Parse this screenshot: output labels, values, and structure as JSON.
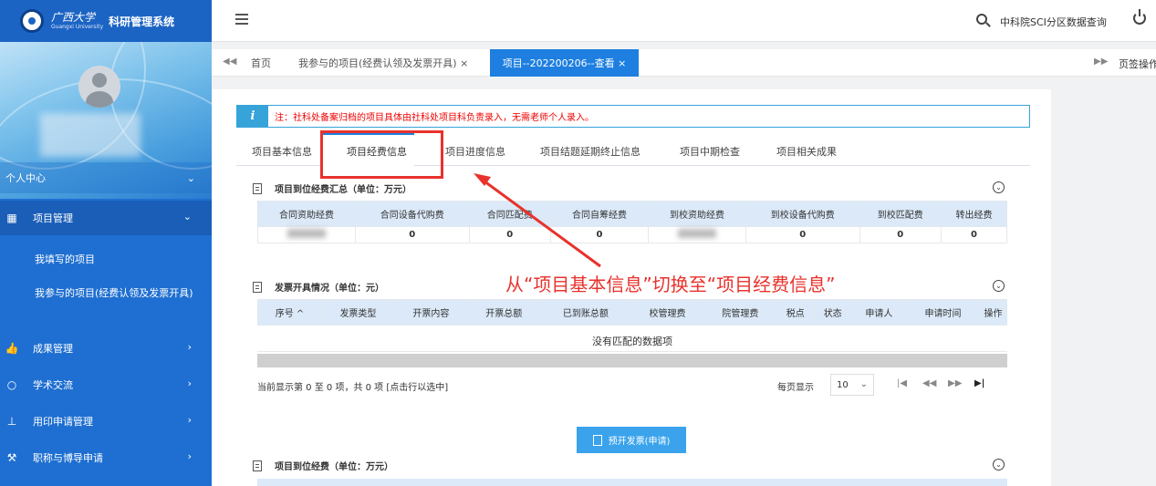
{
  "app": {
    "logo_cn": "广西大学",
    "logo_en": "Guangxi University",
    "system_name": "科研管理系统"
  },
  "topbar": {
    "link": "中科院SCI分区数据查询"
  },
  "sidebar": {
    "profile_label": "个人中心",
    "items": [
      {
        "label": "项目管理",
        "icon": "grid-icon",
        "expanded": true
      },
      {
        "label": "成果管理",
        "icon": "thumbs-up-icon"
      },
      {
        "label": "学术交流",
        "icon": "circle-icon"
      },
      {
        "label": "用印申请管理",
        "icon": "stamp-icon"
      },
      {
        "label": "职称与博导申请",
        "icon": "hammer-icon"
      }
    ],
    "sub_items": [
      {
        "label": "我填写的项目"
      },
      {
        "label": "我参与的项目(经费认领及发票开具)"
      }
    ]
  },
  "page_tabs": {
    "home": "首页",
    "my_projects": "我参与的项目(经费认领及发票开具) ×",
    "active": "项目--202200206--查看 ×",
    "ops": "页签操作"
  },
  "notice": {
    "icon": "i",
    "text": "注：社科处备案归档的项目具体由社科处项目科负责录入，无需老师个人录入。"
  },
  "inner_tabs": {
    "basic": "项目基本信息",
    "funding": "项目经费信息",
    "progress": "项目进度信息",
    "delay": "项目结题延期终止信息",
    "mid": "项目中期检查",
    "results": "项目相关成果"
  },
  "section1": {
    "title": "项目到位经费汇总（单位：万元）",
    "headers": [
      "合同资助经费",
      "合同设备代购费",
      "合同匹配费",
      "合同自筹经费",
      "到校资助经费",
      "到校设备代购费",
      "到校匹配费",
      "转出经费"
    ],
    "values": [
      "",
      "0",
      "0",
      "0",
      "",
      "0",
      "0",
      "0"
    ]
  },
  "section2": {
    "title": "发票开具情况（单位：元）",
    "headers": [
      "序号 ^",
      "发票类型",
      "开票内容",
      "开票总额",
      "已到账总额",
      "校管理费",
      "院管理费",
      "税点",
      "状态",
      "申请人",
      "申请时间",
      "操作"
    ],
    "empty": "没有匹配的数据项",
    "pager_info": "当前显示第 0 至 0 项，共 0 项  [点击行以选中]",
    "per_page_label": "每页显示",
    "per_page": "10"
  },
  "preinvoice_button": "预开发票(申请)",
  "section3": {
    "title": "项目到位经费（单位：万元）"
  },
  "annotation": {
    "text": "从“项目基本信息”切换至“项目经费信息”",
    "color": "#e8322c"
  }
}
